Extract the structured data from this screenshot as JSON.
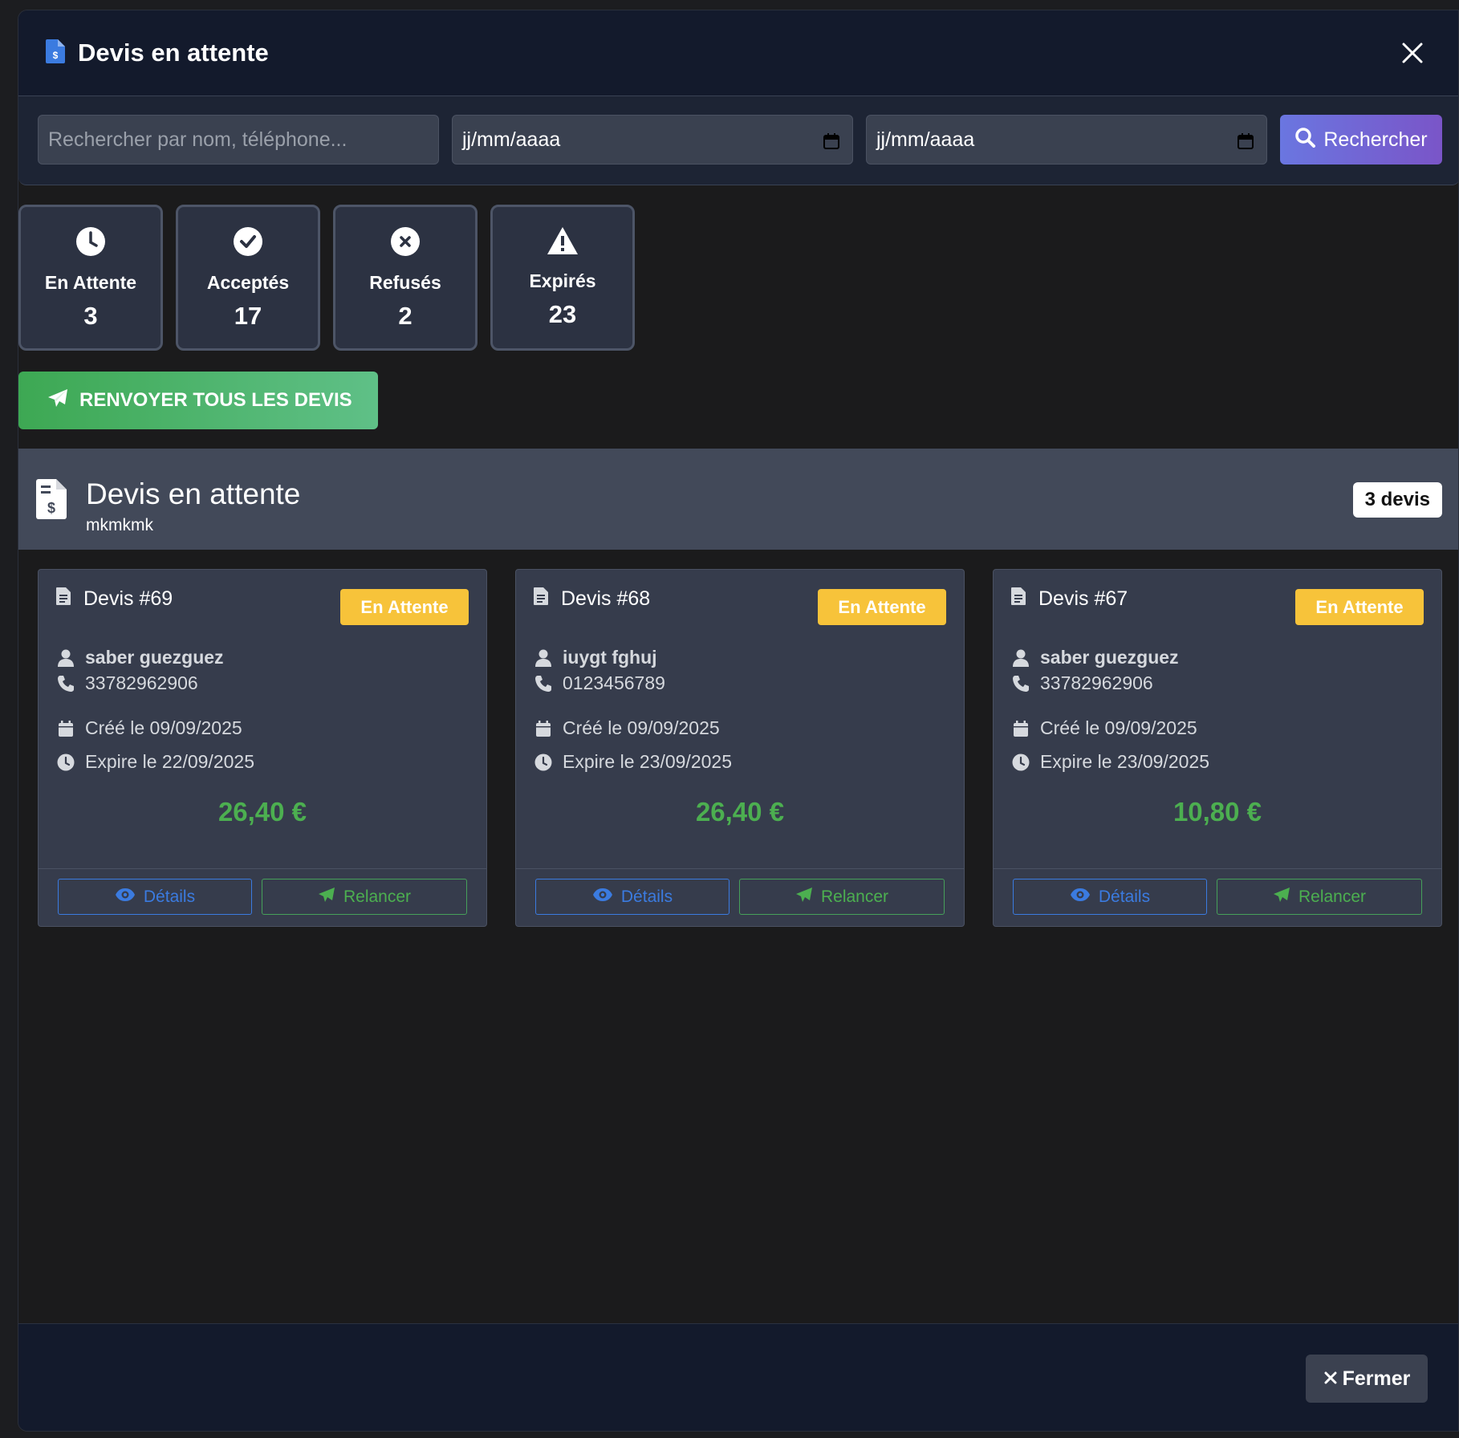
{
  "header": {
    "title": "Devis en attente",
    "close_label": "×"
  },
  "filters": {
    "search_placeholder": "Rechercher par nom, téléphone...",
    "date_from": "jj/mm/aaaa",
    "date_to": "jj/mm/aaaa",
    "search_button": "Rechercher"
  },
  "stats": [
    {
      "label": "En Attente",
      "count": "3",
      "icon": "clock-icon"
    },
    {
      "label": "Acceptés",
      "count": "17",
      "icon": "check-circle-icon"
    },
    {
      "label": "Refusés",
      "count": "2",
      "icon": "x-circle-icon"
    },
    {
      "label": "Expirés",
      "count": "23",
      "icon": "warning-icon"
    }
  ],
  "resend_all_label": "RENVOYER TOUS LES DEVIS",
  "section": {
    "title": "Devis en attente",
    "subtitle": "mkmkmk",
    "count_badge": "3 devis"
  },
  "cards": [
    {
      "title": "Devis #69",
      "status": "En Attente",
      "client": "saber guezguez",
      "phone": "33782962906",
      "created": "Créé le 09/09/2025",
      "expires": "Expire le 22/09/2025",
      "price": "26,40 €",
      "details_label": "Détails",
      "relance_label": "Relancer"
    },
    {
      "title": "Devis #68",
      "status": "En Attente",
      "client": "iuygt fghuj",
      "phone": "0123456789",
      "created": "Créé le 09/09/2025",
      "expires": "Expire le 23/09/2025",
      "price": "26,40 €",
      "details_label": "Détails",
      "relance_label": "Relancer"
    },
    {
      "title": "Devis #67",
      "status": "En Attente",
      "client": "saber guezguez",
      "phone": "33782962906",
      "created": "Créé le 09/09/2025",
      "expires": "Expire le 23/09/2025",
      "price": "10,80 €",
      "details_label": "Détails",
      "relance_label": "Relancer"
    }
  ],
  "footer": {
    "close_button": "Fermer"
  },
  "colors": {
    "accent_blue": "#3b7be0",
    "success_green": "#4caf50",
    "warning_yellow": "#f7c33a",
    "header_bg": "#131a2c"
  }
}
